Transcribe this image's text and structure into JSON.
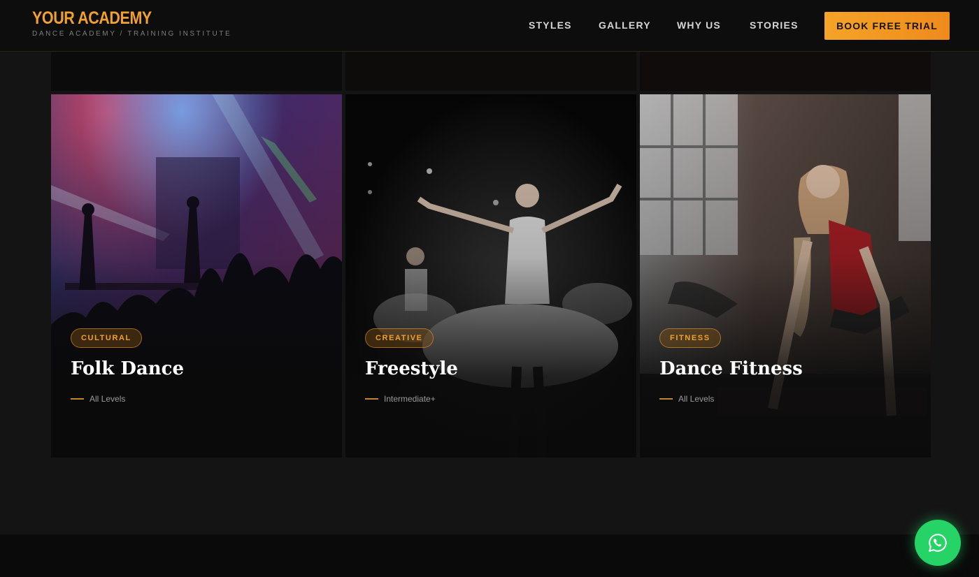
{
  "header": {
    "brand_name": "YOUR ACADEMY",
    "brand_tagline": "DANCE ACADEMY / TRAINING INSTITUTE",
    "nav": [
      {
        "label": "STYLES"
      },
      {
        "label": "GALLERY"
      },
      {
        "label": "WHY US"
      },
      {
        "label": "STORIES"
      }
    ],
    "cta_label": "BOOK FREE TRIAL"
  },
  "cards": [
    {
      "badge": "CULTURAL",
      "title": "Folk Dance",
      "level": "All Levels",
      "image": "concert-crowd-photo"
    },
    {
      "badge": "CREATIVE",
      "title": "Freestyle",
      "level": "Intermediate+",
      "image": "ballet-dancers-photo"
    },
    {
      "badge": "FITNESS",
      "title": "Dance Fitness",
      "level": "All Levels",
      "image": "fitness-workout-photo"
    }
  ],
  "colors": {
    "accent": "#f0a12f",
    "background": "#141414",
    "header": "#0d0d0d",
    "whatsapp": "#25d366"
  },
  "floating": {
    "icon": "whatsapp-icon"
  }
}
